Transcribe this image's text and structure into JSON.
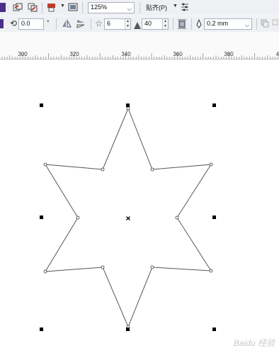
{
  "toolbar_top": {
    "zoom_value": "125%",
    "snap_label": "贴齐(P)"
  },
  "property_bar": {
    "rotation_value": "0.0",
    "rotation_unit": "°",
    "star_points_value": "6",
    "star_sharpness_value": "40",
    "outline_width_value": "0.2 mm"
  },
  "ruler": {
    "labels": [
      "300",
      "320",
      "340",
      "360",
      "380"
    ]
  },
  "canvas": {
    "shape": "six-pointed star",
    "star_points": 6,
    "star_sharpness": 40,
    "outline_color": "#555555",
    "handle_color": "#000000"
  },
  "watermark": "Baidu 经验"
}
